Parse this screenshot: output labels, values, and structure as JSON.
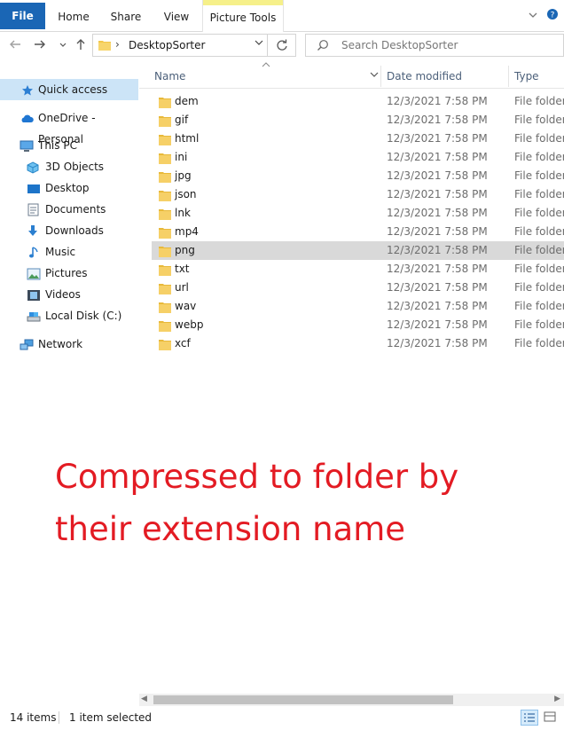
{
  "ribbon": {
    "tabs": [
      "File",
      "Home",
      "Share",
      "View",
      "Picture Tools"
    ]
  },
  "address": {
    "path": "DesktopSorter",
    "search_placeholder": "Search DesktopSorter"
  },
  "nav": {
    "quick_access": "Quick access",
    "onedrive": "OneDrive - Personal",
    "this_pc": "This PC",
    "objects_3d": "3D Objects",
    "desktop": "Desktop",
    "documents": "Documents",
    "downloads": "Downloads",
    "music": "Music",
    "pictures": "Pictures",
    "videos": "Videos",
    "local_disk": "Local Disk (C:)",
    "network": "Network"
  },
  "columns": {
    "name": "Name",
    "date": "Date modified",
    "type": "Type"
  },
  "files": [
    {
      "name": "dem",
      "date": "12/3/2021 7:58 PM",
      "type": "File folder"
    },
    {
      "name": "gif",
      "date": "12/3/2021 7:58 PM",
      "type": "File folder"
    },
    {
      "name": "html",
      "date": "12/3/2021 7:58 PM",
      "type": "File folder"
    },
    {
      "name": "ini",
      "date": "12/3/2021 7:58 PM",
      "type": "File folder"
    },
    {
      "name": "jpg",
      "date": "12/3/2021 7:58 PM",
      "type": "File folder"
    },
    {
      "name": "json",
      "date": "12/3/2021 7:58 PM",
      "type": "File folder"
    },
    {
      "name": "lnk",
      "date": "12/3/2021 7:58 PM",
      "type": "File folder"
    },
    {
      "name": "mp4",
      "date": "12/3/2021 7:58 PM",
      "type": "File folder"
    },
    {
      "name": "png",
      "date": "12/3/2021 7:58 PM",
      "type": "File folder"
    },
    {
      "name": "txt",
      "date": "12/3/2021 7:58 PM",
      "type": "File folder"
    },
    {
      "name": "url",
      "date": "12/3/2021 7:58 PM",
      "type": "File folder"
    },
    {
      "name": "wav",
      "date": "12/3/2021 7:58 PM",
      "type": "File folder"
    },
    {
      "name": "webp",
      "date": "12/3/2021 7:58 PM",
      "type": "File folder"
    },
    {
      "name": "xcf",
      "date": "12/3/2021 7:58 PM",
      "type": "File folder"
    }
  ],
  "annotation": {
    "line1": "Compressed to folder by",
    "line2": "their extension name"
  },
  "status": {
    "count": "14 items",
    "selected": "1 item selected"
  },
  "colors": {
    "file_tab": "#1a66b5",
    "folder": "#f3c74a",
    "selected_nav": "#cce4f7",
    "selected_row": "#d9d9d9",
    "annotation": "#e31b23"
  }
}
